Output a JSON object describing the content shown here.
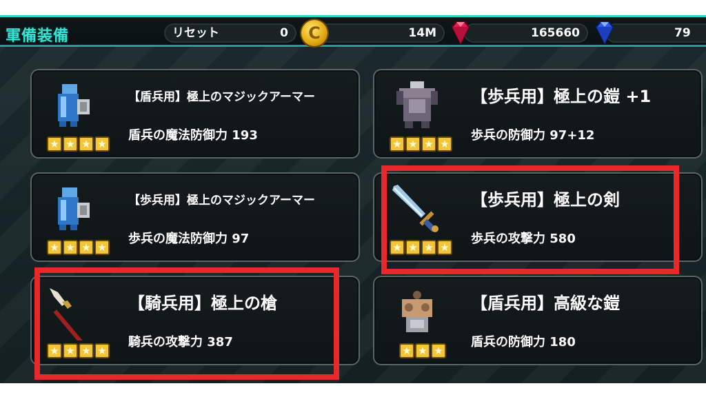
{
  "header": {
    "title": "軍備装備",
    "reset_label": "リセット",
    "reset_value": "0",
    "gold_value": "14M",
    "red_gem_value": "165660",
    "blue_gem_value": "79",
    "coin_symbol": "C"
  },
  "items": [
    {
      "name": "【盾兵用】極上のマジックアーマー",
      "stat": "盾兵の魔法防御力 193",
      "stars": 4,
      "icon": "blue-magic-armor-icon"
    },
    {
      "name": "【歩兵用】極上の鎧 +1",
      "stat": "歩兵の防御力 97+12",
      "stars": 4,
      "icon": "gray-armor-icon"
    },
    {
      "name": "【歩兵用】極上のマジックアーマー",
      "stat": "歩兵の魔法防御力 97",
      "stars": 4,
      "icon": "blue-magic-armor-icon"
    },
    {
      "name": "【歩兵用】極上の剣",
      "stat": "歩兵の攻撃力 580",
      "stars": 4,
      "icon": "sword-icon"
    },
    {
      "name": "【騎兵用】極上の槍",
      "stat": "騎兵の攻撃力 387",
      "stars": 4,
      "icon": "spear-icon"
    },
    {
      "name": "【盾兵用】高級な鎧",
      "stat": "盾兵の防御力 180",
      "stars": 3,
      "icon": "bronze-armor-icon"
    }
  ],
  "star_glyph": "★",
  "colors": {
    "accent": "#35e2d4",
    "highlight": "#e8282b",
    "star": "#f2c53b"
  }
}
